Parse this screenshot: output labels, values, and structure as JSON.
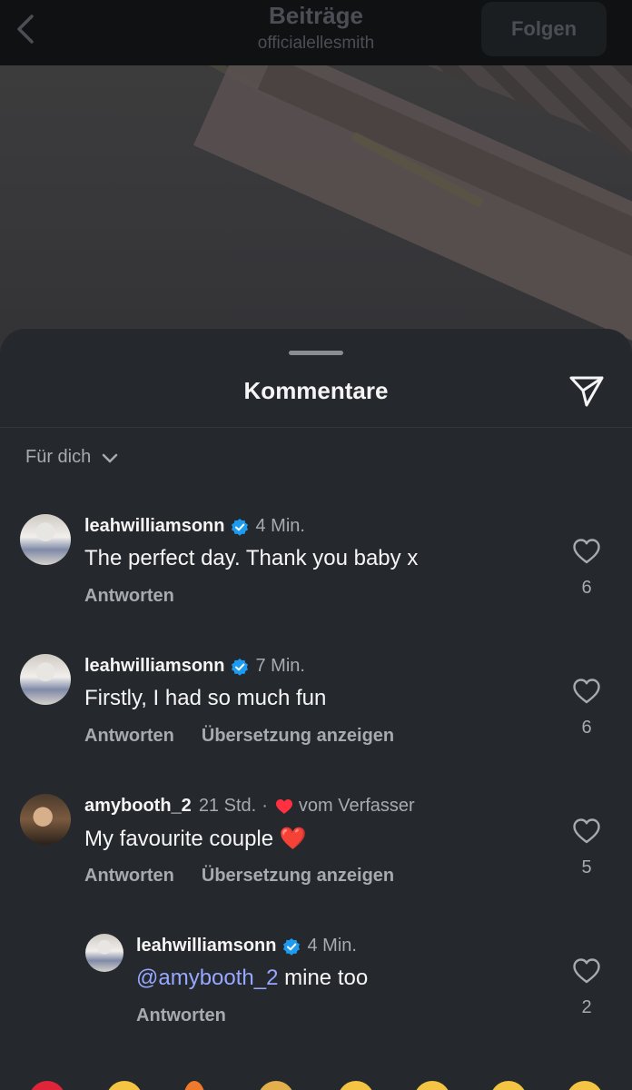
{
  "header": {
    "title": "Beiträge",
    "subtitle": "officialellesmith",
    "follow_label": "Folgen"
  },
  "sheet": {
    "title": "Kommentare",
    "filter_label": "Für dich"
  },
  "comments": [
    {
      "username": "leahwilliamsonn",
      "verified": true,
      "time": "4 Min.",
      "text": "The perfect day. Thank you baby x",
      "reply_label": "Antworten",
      "likes": "6"
    },
    {
      "username": "leahwilliamsonn",
      "verified": true,
      "time": "7 Min.",
      "text": "Firstly, I had so much fun",
      "reply_label": "Antworten",
      "translate_label": "Übersetzung anzeigen",
      "likes": "6"
    },
    {
      "username": "amybooth_2",
      "verified": false,
      "time": "21 Std.",
      "separator": "·",
      "author_label": "vom Verfasser",
      "text": "My favourite couple ❤️",
      "reply_label": "Antworten",
      "translate_label": "Übersetzung anzeigen",
      "likes": "5"
    }
  ],
  "reply": {
    "username": "leahwilliamsonn",
    "verified": true,
    "time": "4 Min.",
    "mention": "@amybooth_2",
    "text": " mine too",
    "reply_label": "Antworten",
    "likes": "2"
  },
  "colors": {
    "verified_blue": "#1d9bf0",
    "heart_red": "#ff3040",
    "mention_blue": "#96a8ff",
    "sheet_bg": "#25282c"
  },
  "icons": [
    "back-chevron-icon",
    "send-icon",
    "chevron-down-icon",
    "verified-badge-icon",
    "heart-outline-icon",
    "heart-filled-icon"
  ]
}
